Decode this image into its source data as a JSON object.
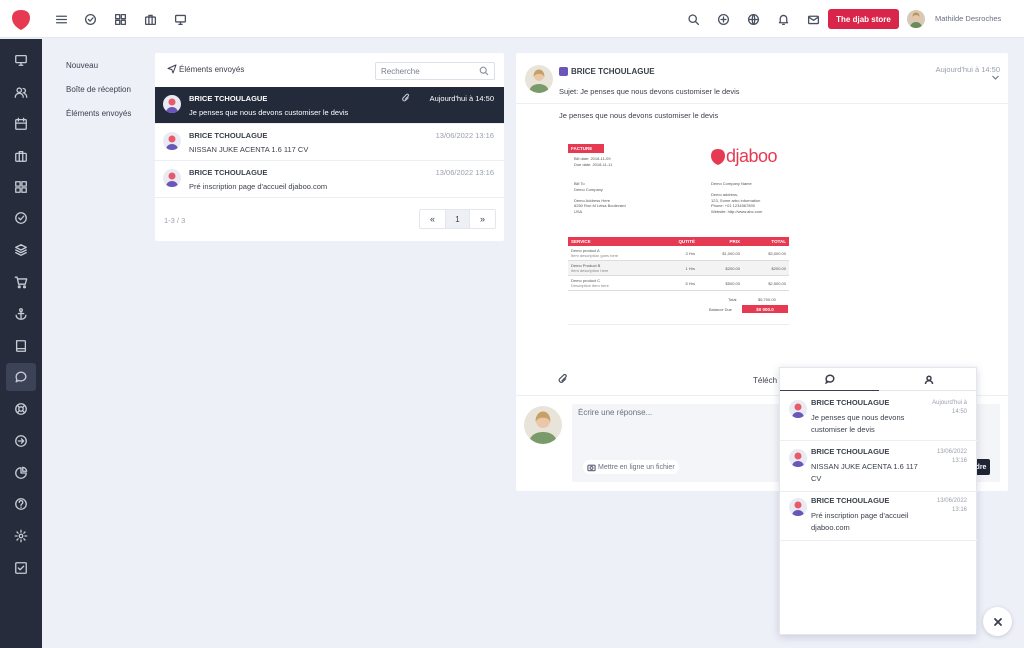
{
  "colors": {
    "brand": "#d9254a",
    "sidebar": "#262c3b",
    "selected_row": "#232a3a",
    "invoice_accent": "#e63a52"
  },
  "topbar": {
    "icons": [
      "menu-icon",
      "check-circle-icon",
      "grid-icon",
      "briefcase-icon",
      "monitor-icon",
      "search-icon",
      "plus-circle-icon",
      "globe-icon",
      "bell-icon",
      "mail-icon"
    ],
    "store_button": "The djab store",
    "user_name": "Mathilde Desroches"
  },
  "sidebar": {
    "icons": [
      "monitor-icon",
      "users-icon",
      "calendar-icon",
      "briefcase-icon",
      "grid-icon",
      "check-circle-icon",
      "layers-icon",
      "cart-icon",
      "anchor-icon",
      "book-icon",
      "chat-icon",
      "lifebuoy-icon",
      "arrow-right-circle-icon",
      "pie-chart-icon",
      "help-icon",
      "settings-icon",
      "checkbox-icon"
    ],
    "active_index": 10
  },
  "folders": [
    "Nouveau",
    "Boîte de réception",
    "Éléments envoyés"
  ],
  "list": {
    "title": "Éléments envoyés",
    "search_placeholder": "Recherche",
    "rows": [
      {
        "sender": "BRICE TCHOULAGUE",
        "subject": "Je penses que nous devons customiser le devis",
        "time": "Aujourd'hui à 14:50",
        "has_attachment": true,
        "selected": true
      },
      {
        "sender": "BRICE TCHOULAGUE",
        "subject": "NISSAN JUKE ACENTA 1.6 117 CV",
        "time": "13/06/2022 13:16",
        "has_attachment": false,
        "selected": false
      },
      {
        "sender": "BRICE TCHOULAGUE",
        "subject": "Pré inscription page d'accueil djaboo.com",
        "time": "13/06/2022 13:16",
        "has_attachment": false,
        "selected": false
      }
    ],
    "count": "1-3 / 3",
    "pager": {
      "prev": "«",
      "current": "1",
      "next": "»"
    }
  },
  "detail": {
    "sender": "BRICE TCHOULAGUE",
    "time": "Aujourd'hui à 14:50",
    "subject": "Sujet: Je penses que nous devons customiser le devis",
    "body": "Je penses que nous devons customiser le devis",
    "download_label": "Téléch",
    "reply_placeholder": "Écrire une réponse...",
    "inline_file_label": "Mettre en ligne un fichier",
    "send_label": "dre"
  },
  "invoice": {
    "header": "FACTURE",
    "bill_dates": "Bill date: 2018-11-09\nDue date: 2018-11-11",
    "bill_to": "Bill To\nDemo Company\n\nDemo Address Here\n6250 Ron M Leisa Boulevard\nUSA",
    "brand": "djaboo",
    "company": "Demo Company Name\n\nDemo address,\n123, Some arbo information\nPhone: +01 1234567890\nWebsite: http://www.abc.com",
    "columns": [
      "SERVICE",
      "QUTITÉ",
      "PRIX",
      "TOTAL"
    ],
    "items": [
      {
        "name": "Demo product A",
        "desc": "Item description goes here",
        "qty": "3 Hrs",
        "price": "$1,000.00",
        "total": "$3,000.00"
      },
      {
        "name": "Demo Product B",
        "desc": "Item description here",
        "qty": "1 Hrs",
        "price": "$200.00",
        "total": "$200.00"
      },
      {
        "name": "Demo product C",
        "desc": "Description item here",
        "qty": "5 Hrs",
        "price": "$500.00",
        "total": "$2,500.00"
      }
    ],
    "total_label": "Total",
    "total_value": "$5,700.00",
    "balance_label": "Balance Due",
    "balance_value": "$0 000.0"
  },
  "chat_panel": {
    "tabs": [
      "chat-icon",
      "user-icon"
    ],
    "items": [
      {
        "sender": "BRICE TCHOULAGUE",
        "message": "Je penses que nous devons customiser le devis",
        "time": "Aujourd'hui à 14:50"
      },
      {
        "sender": "BRICE TCHOULAGUE",
        "message": "NISSAN JUKE ACENTA 1.6 117 CV",
        "time": "13/06/2022 13:16"
      },
      {
        "sender": "BRICE TCHOULAGUE",
        "message": "Pré inscription page d'accueil djaboo.com",
        "time": "13/06/2022 13:16"
      }
    ]
  }
}
